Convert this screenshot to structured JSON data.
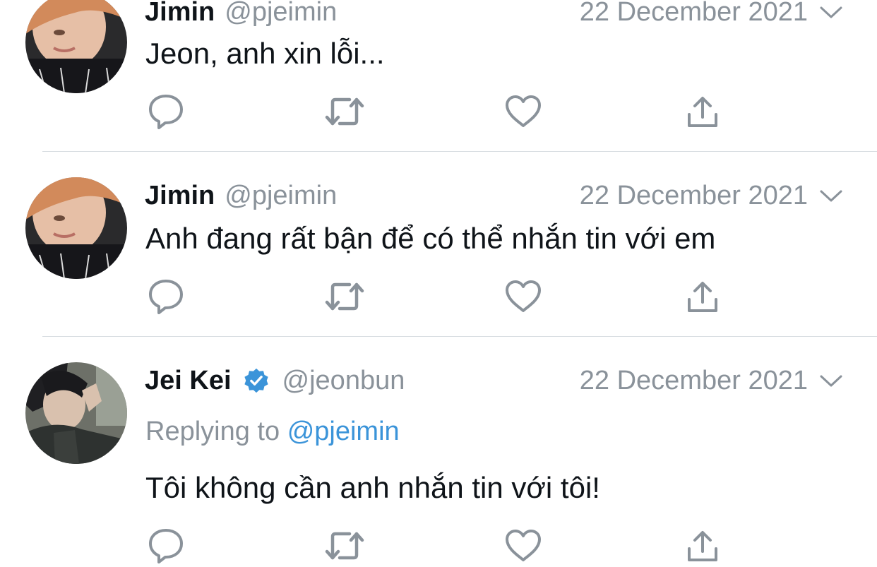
{
  "colors": {
    "text": "#0f1419",
    "muted": "#8a929a",
    "mention": "#3b94d9",
    "verified": "#3b94d9",
    "icon": "#8a929a",
    "divider": "#d8dde1"
  },
  "tweets": [
    {
      "display_name": "Jimin",
      "handle": "@pjeimin",
      "date": "22 December 2021",
      "text": "Jeon, anh xin lỗi...",
      "verified": false
    },
    {
      "display_name": "Jimin",
      "handle": "@pjeimin",
      "date": "22 December 2021",
      "text": "Anh đang rất bận để có thể nhắn tin với em",
      "verified": false
    },
    {
      "display_name": "Jei Kei",
      "handle": "@jeonbun",
      "date": "22 December 2021",
      "reply_prefix": "Replying to",
      "reply_mention": "@pjeimin",
      "text": "Tôi không cần anh nhắn tin với tôi!",
      "verified": true
    }
  ],
  "icons": {
    "reply": "reply-bubble-icon",
    "retweet": "retweet-icon",
    "like": "heart-icon",
    "share": "share-upload-icon",
    "menu": "chevron-down-icon",
    "verified": "verified-badge-icon"
  }
}
